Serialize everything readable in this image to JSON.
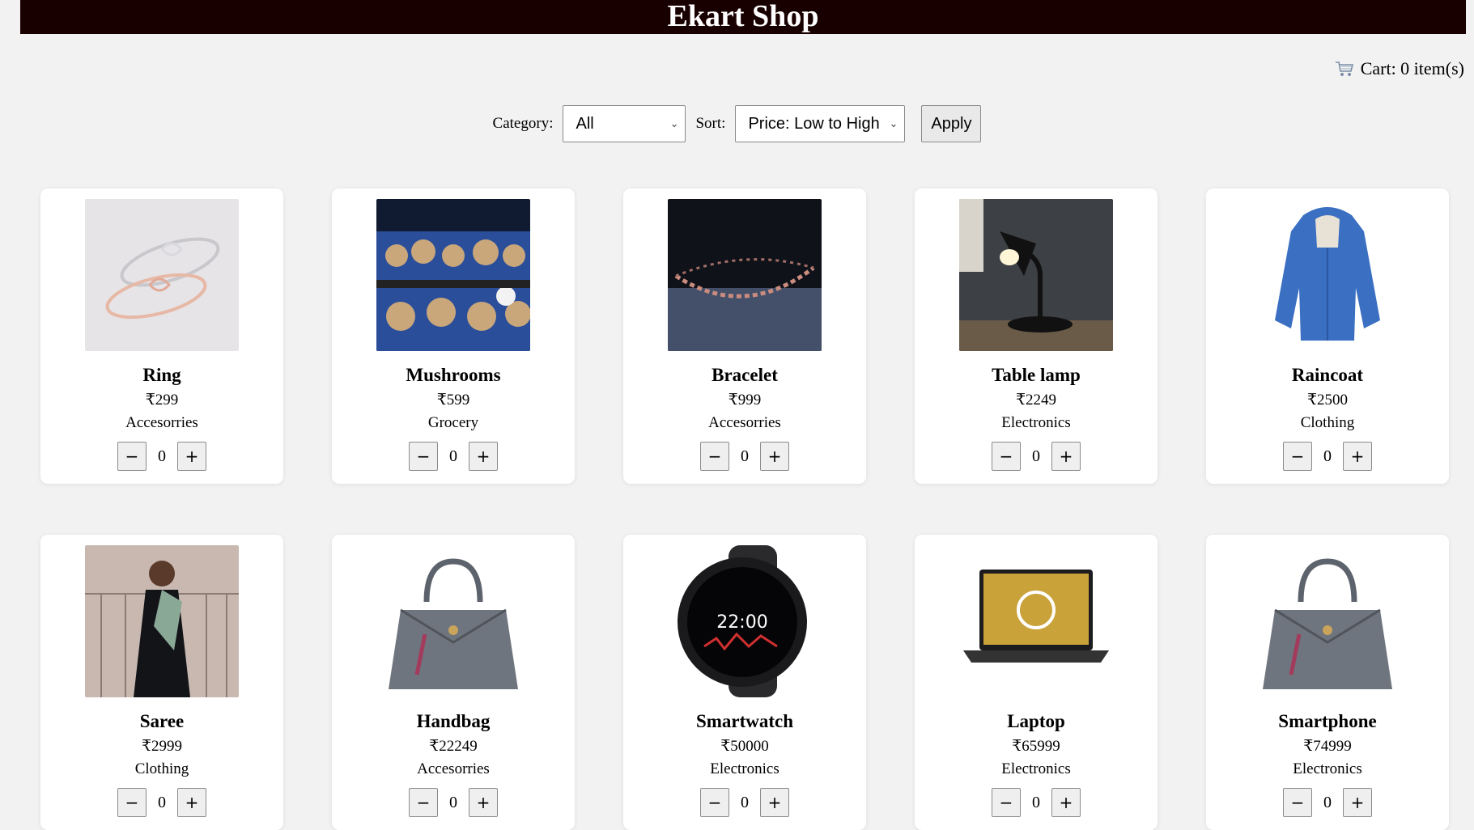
{
  "header": {
    "title": "Ekart Shop"
  },
  "cart": {
    "label": "Cart: 0 item(s)",
    "icon": "shopping-cart-icon"
  },
  "filters": {
    "category_label": "Category:",
    "category_value": "All",
    "sort_label": "Sort:",
    "sort_value": "Price: Low to High",
    "apply_label": "Apply"
  },
  "qty_controls": {
    "minus": "−",
    "plus": "+"
  },
  "products": [
    {
      "name": "Ring",
      "price": "₹299",
      "category": "Accesorries",
      "qty": "0",
      "image": "ring"
    },
    {
      "name": "Mushrooms",
      "price": "₹599",
      "category": "Grocery",
      "qty": "0",
      "image": "mushrooms"
    },
    {
      "name": "Bracelet",
      "price": "₹999",
      "category": "Accesorries",
      "qty": "0",
      "image": "bracelet"
    },
    {
      "name": "Table lamp",
      "price": "₹2249",
      "category": "Electronics",
      "qty": "0",
      "image": "lamp"
    },
    {
      "name": "Raincoat",
      "price": "₹2500",
      "category": "Clothing",
      "qty": "0",
      "image": "raincoat"
    },
    {
      "name": "Saree",
      "price": "₹2999",
      "category": "Clothing",
      "qty": "0",
      "image": "saree"
    },
    {
      "name": "Handbag",
      "price": "₹22249",
      "category": "Accesorries",
      "qty": "0",
      "image": "handbag"
    },
    {
      "name": "Smartwatch",
      "price": "₹50000",
      "category": "Electronics",
      "qty": "0",
      "image": "smartwatch"
    },
    {
      "name": "Laptop",
      "price": "₹65999",
      "category": "Electronics",
      "qty": "0",
      "image": "laptop"
    },
    {
      "name": "Smartphone",
      "price": "₹74999",
      "category": "Electronics",
      "qty": "0",
      "image": "handbag"
    }
  ]
}
